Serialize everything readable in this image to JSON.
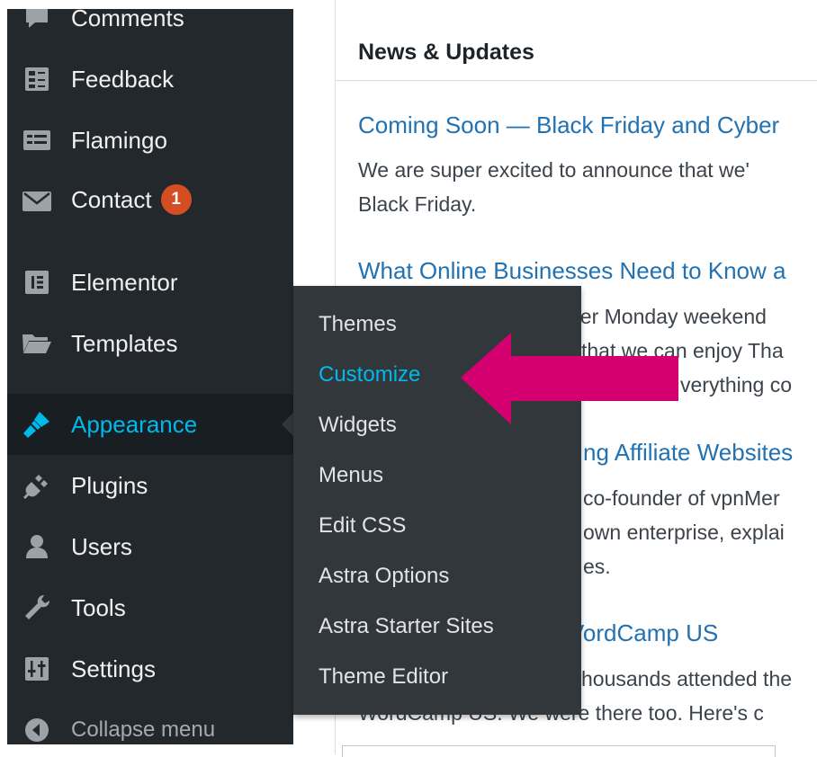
{
  "sidebar": {
    "items": [
      {
        "label": "Comments",
        "icon": "comments-icon"
      },
      {
        "label": "Feedback",
        "icon": "feedback-icon"
      },
      {
        "label": "Flamingo",
        "icon": "flamingo-icon"
      },
      {
        "label": "Contact",
        "icon": "mail-icon",
        "badge": "1"
      },
      {
        "label": "Elementor",
        "icon": "elementor-icon"
      },
      {
        "label": "Templates",
        "icon": "folder-icon"
      },
      {
        "label": "Appearance",
        "icon": "paintbrush-icon",
        "active": true
      },
      {
        "label": "Plugins",
        "icon": "plugin-icon"
      },
      {
        "label": "Users",
        "icon": "user-icon"
      },
      {
        "label": "Tools",
        "icon": "wrench-icon"
      },
      {
        "label": "Settings",
        "icon": "settings-icon"
      },
      {
        "label": "Collapse menu",
        "icon": "collapse-icon"
      }
    ]
  },
  "submenu": {
    "items": [
      {
        "label": "Themes"
      },
      {
        "label": "Customize",
        "current": true
      },
      {
        "label": "Widgets"
      },
      {
        "label": "Menus"
      },
      {
        "label": "Edit CSS"
      },
      {
        "label": "Astra Options"
      },
      {
        "label": "Astra Starter Sites"
      },
      {
        "label": "Theme Editor"
      }
    ]
  },
  "news": {
    "title": "News & Updates",
    "articles": [
      {
        "title": "Coming Soon — Black Friday and Cyber",
        "lines": [
          "We are super excited to announce that we'",
          "Black Friday."
        ]
      },
      {
        "title": "What Online Businesses Need to Know a",
        "lines": [
          "ber Monday weekend",
          "that we can enjoy Tha",
          "verything co"
        ]
      },
      {
        "title": "ng Affiliate Websites",
        "lines": [
          "co-founder of vpnMer",
          "own enterprise, explai",
          "es."
        ]
      },
      {
        "title": "VordCamp US",
        "lines": [
          "housands attended the",
          "WordCamp US. We were there too. Here's c"
        ]
      }
    ]
  },
  "colors": {
    "sidebar_bg": "#23282d",
    "submenu_bg": "#32373c",
    "accent": "#00b9eb",
    "link": "#2271b1",
    "badge": "#d54e21",
    "arrow": "#d4006f"
  }
}
